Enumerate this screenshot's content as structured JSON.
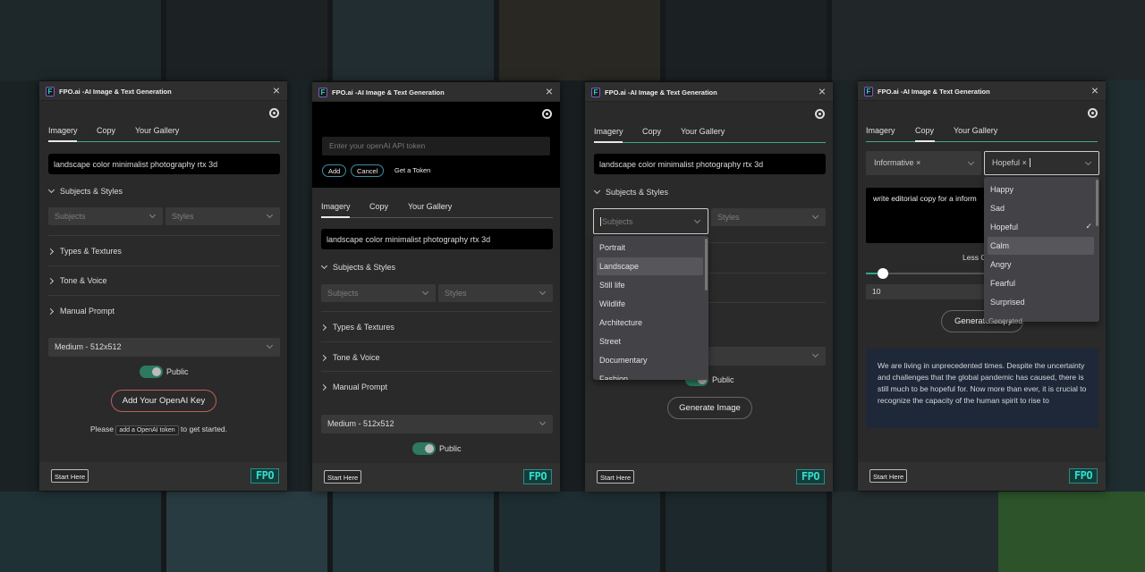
{
  "common": {
    "title": "FPO.ai -AI Image & Text Generation",
    "tabs": [
      "Imagery",
      "Copy",
      "Your Gallery"
    ],
    "prompt": "landscape color minimalist photography rtx 3d",
    "sections": [
      "Subjects & Styles",
      "Types & Textures",
      "Tone & Voice",
      "Manual Prompt"
    ],
    "subjects_placeholder": "Subjects",
    "styles_placeholder": "Styles",
    "size": "Medium - 512x512",
    "public_label": "Public",
    "public_on": true,
    "start_here": "Start Here",
    "logo": "FPO",
    "accent_color": "#3fa88a",
    "icons": [
      "app-logo-icon",
      "close-icon",
      "gear-icon",
      "chevron-down-icon",
      "chevron-right-icon",
      "check-icon"
    ]
  },
  "panel1": {
    "active_tab": "Imagery",
    "add_key_button": "Add Your OpenAI Key",
    "please_prefix": "Please",
    "token_link": "add a OpenAI token",
    "please_suffix": "to get started."
  },
  "panel2": {
    "active_tab": "Imagery",
    "token_placeholder": "Enter your openAI API token",
    "add": "Add",
    "cancel": "Cancel",
    "get_token": "Get a Token"
  },
  "panel3": {
    "active_tab": "Imagery",
    "subject_options": [
      "Portrait",
      "Landscape",
      "Still life",
      "Wildlife",
      "Architecture",
      "Street",
      "Documentary",
      "Fashion"
    ],
    "highlighted": "Landscape",
    "generate_image": "Generate Image"
  },
  "panel4": {
    "active_tab": "Copy",
    "tone": "Informative",
    "emotion": "Hopeful",
    "emotion_options": [
      "Happy",
      "Sad",
      "Hopeful",
      "Calm",
      "Angry",
      "Fearful",
      "Surprised"
    ],
    "selected": "Hopeful",
    "highlighted": "Calm",
    "copy_prompt": "write editorial copy for a  inform",
    "slider_label": "Less C",
    "slider_value": "10",
    "generate_copy": "Generate Copy",
    "generate_copy_overlap": "Generated",
    "output": "We are living in unprecedented times. Despite the uncertainty and challenges that the global pandemic has caused, there is still much to be hopeful for. Now more than ever, it is crucial to recognize the capacity of the human spirit to rise to"
  }
}
